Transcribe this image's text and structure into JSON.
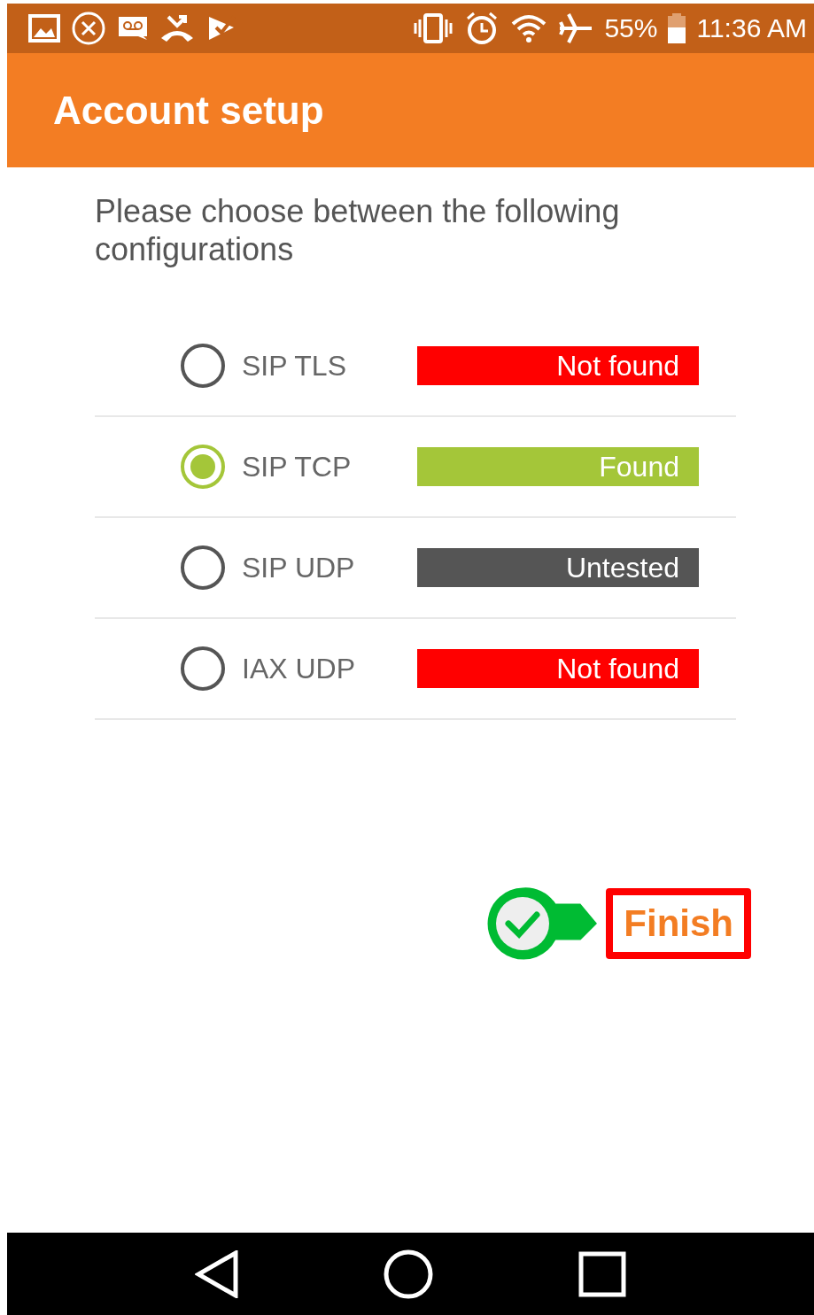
{
  "status_bar": {
    "battery": "55%",
    "time": "11:36 AM"
  },
  "app_bar": {
    "title": "Account setup"
  },
  "prompt": "Please choose between the following configurations",
  "options": [
    {
      "label": "SIP TLS",
      "selected": false,
      "status": "Not found",
      "color": "#ff0000"
    },
    {
      "label": "SIP TCP",
      "selected": true,
      "status": "Found",
      "color": "#a4c639"
    },
    {
      "label": "SIP UDP",
      "selected": false,
      "status": "Untested",
      "color": "#555555"
    },
    {
      "label": "IAX UDP",
      "selected": false,
      "status": "Not found",
      "color": "#ff0000"
    }
  ],
  "finish_button": {
    "label": "Finish"
  }
}
